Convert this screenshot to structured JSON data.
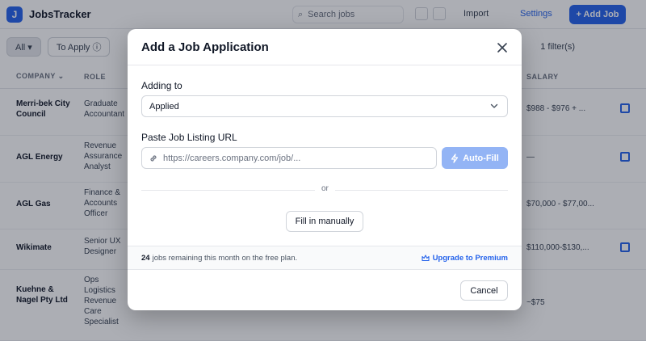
{
  "app": {
    "brand": "JobsTracker",
    "search_placeholder": "Search jobs",
    "import_label": "Import",
    "settings_label": "Settings",
    "add_job_label": "+ Add Job",
    "filters": [
      {
        "label": "All ▾"
      },
      {
        "label": "To Apply ⓘ"
      }
    ],
    "filter_right": "1 filter(s)",
    "columns": {
      "company": "Company ⌄",
      "role": "Role",
      "salary": "Salary"
    },
    "rows": [
      {
        "company": "Merri-bek City Council",
        "role": "Graduate Accountant",
        "salary": "$988 - $976 + ..."
      },
      {
        "company": "AGL Energy",
        "role": "Revenue Assurance Analyst",
        "salary": "—"
      },
      {
        "company": "AGL Gas",
        "role": "Finance & Accounts Officer",
        "salary": "$70,000 - $77,00..."
      },
      {
        "company": "Wikimate",
        "role": "Senior UX Designer",
        "salary": "$110,000-$130,..."
      },
      {
        "company": "Kuehne & Nagel Pty Ltd",
        "role": "Ops Logistics Revenue Care Specialist",
        "salary": "~$75"
      }
    ]
  },
  "modal": {
    "title": "Add a Job Application",
    "adding_to_label": "Adding to",
    "adding_to_value": "Applied",
    "url_label": "Paste Job Listing URL",
    "url_placeholder": "https://careers.company.com/job/...",
    "autofill_label": "Auto-Fill",
    "or_text": "or",
    "manual_label": "Fill in manually",
    "jobs_remaining_count": "24",
    "jobs_remaining_text": "jobs remaining this month on the free plan.",
    "upgrade_label": "Upgrade to Premium",
    "cancel_label": "Cancel"
  },
  "colors": {
    "accent": "#2563eb",
    "autofill_disabled": "#93b4f5"
  },
  "icons": {
    "close": "close-icon",
    "chevron": "chevron-down-icon",
    "link": "link-icon",
    "autofill": "lightning-icon",
    "upgrade": "crown-icon",
    "search": "search-icon"
  }
}
